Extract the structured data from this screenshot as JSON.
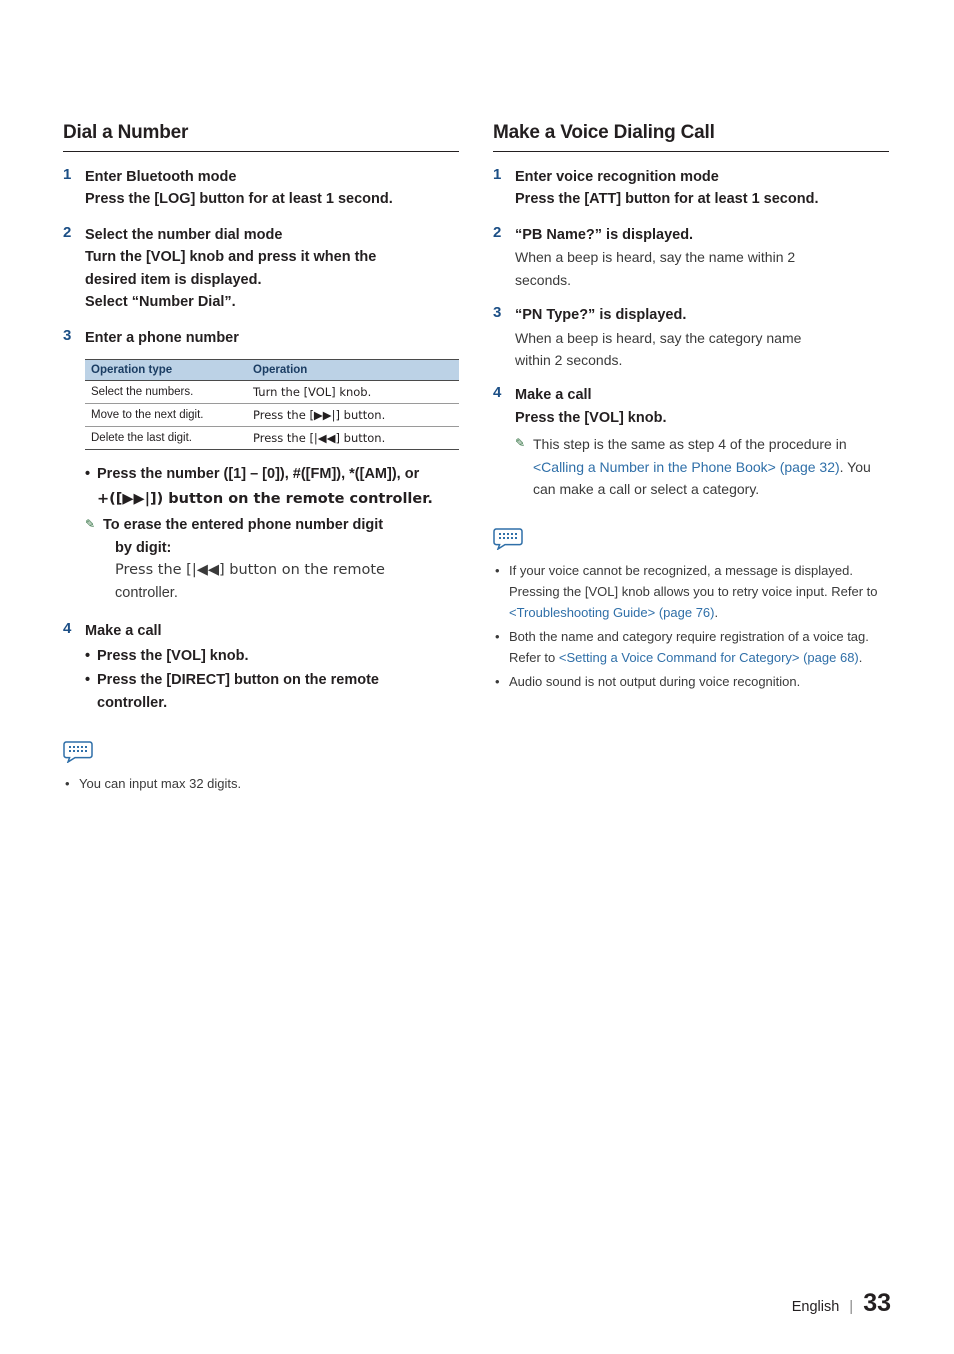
{
  "left_column": {
    "title": "Dial a Number",
    "steps": [
      {
        "num": "1",
        "head": "Enter Bluetooth mode",
        "sub": "Press the [LOG] button for at least 1 second."
      },
      {
        "num": "2",
        "head": "Select the number dial mode",
        "sub1": "Turn the [VOL] knob and press it when the",
        "sub2": "desired item is displayed.",
        "sub3": "Select “Number Dial”."
      },
      {
        "num": "3",
        "head": "Enter a phone number"
      },
      {
        "num": "4",
        "head": "Make a call"
      }
    ],
    "table": {
      "headers": [
        "Operation type",
        "Operation"
      ],
      "rows": [
        [
          "Select the numbers.",
          "Turn the [VOL] knob."
        ],
        [
          "Move to the next digit.",
          "Press the [▶▶|] button."
        ],
        [
          "Delete the last digit.",
          "Press the [|◀◀] button."
        ]
      ]
    },
    "bullets": [
      "Press the number ([1] – [0]), #([FM]), *([AM]), or",
      "+([▶▶|]) button on the remote controller."
    ],
    "erase_note": {
      "pen": "✎",
      "line1": "To erase the entered phone number digit",
      "line2": "by digit:",
      "line3": "Press the [|◀◀] button on the remote",
      "line4": "controller."
    },
    "step4_bullets": [
      "Press the [VOL] knob.",
      "Press the [DIRECT] button on the remote",
      "controller."
    ],
    "memo": [
      "You can input max 32 digits."
    ]
  },
  "right_column": {
    "title": "Make a Voice Dialing Call",
    "steps": [
      {
        "num": "1",
        "head": "Enter voice recognition mode",
        "sub": "Press the [ATT] button for at least 1 second."
      },
      {
        "num": "2",
        "head": "“PB Name?” is displayed.",
        "body1": "When a beep is heard, say the name within 2",
        "body2": "seconds."
      },
      {
        "num": "3",
        "head": "“PN Type?” is displayed.",
        "body1": "When a beep is heard, say the category name",
        "body2": "within 2 seconds."
      },
      {
        "num": "4",
        "head": "Make a call",
        "sub": "Press the [VOL] knob."
      }
    ],
    "step4_note": {
      "pen": "✎",
      "text1": "This step is the same as step 4 of the procedure",
      "text2_pre": "in ",
      "text2_link": "<Calling a Number in the Phone Book> (page",
      "text3_link": "32)",
      "text3_post": ". You can make a call or select a category."
    },
    "memo": [
      {
        "plain1": "If your voice cannot be recognized, a message is displayed. Pressing the [VOL] knob allows you to retry voice input. Refer to ",
        "link1": "<Troubleshooting Guide> (page 76)",
        "plain2": "."
      },
      {
        "plain1": "Both the name and category require registration of a voice tag. Refer to ",
        "link1": "<Setting a Voice Command for Category> (page 68)",
        "plain2": "."
      },
      {
        "plain1": "Audio sound is not output during voice recognition."
      }
    ]
  },
  "footer": {
    "language": "English",
    "separator": "|",
    "page_number": "33"
  },
  "colors": {
    "step_number": "#1c4f86",
    "link": "#2f6fa8",
    "table_header_bg": "#bcd2e6",
    "table_header_text": "#1b3d63"
  }
}
